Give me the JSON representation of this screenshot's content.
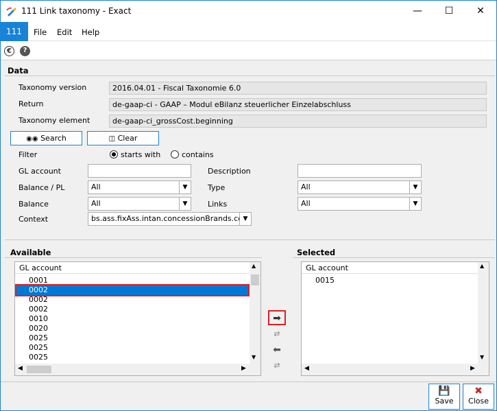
{
  "window": {
    "title": "111 Link taxonomy - Exact",
    "minimize": "—",
    "maximize": "☐",
    "close": "✕"
  },
  "menu": {
    "badge": "111",
    "items": [
      "File",
      "Edit",
      "Help"
    ]
  },
  "data_section": {
    "header": "Data",
    "taxonomy_version_label": "Taxonomy version",
    "taxonomy_version_value": "2016.04.01 - Fiscal Taxonomie 6.0",
    "return_label": "Return",
    "return_value": "de-gaap-ci - GAAP – Modul eBilanz steuerlicher Einzelabschluss",
    "taxonomy_element_label": "Taxonomy element",
    "taxonomy_element_value": "de-gaap-ci_grossCost.beginning",
    "search_label": "Search",
    "clear_label": "Clear",
    "filter_label": "Filter",
    "starts_with_label": "starts with",
    "contains_label": "contains",
    "gl_account_label": "GL account",
    "gl_account_value": "",
    "description_label": "Description",
    "description_value": "",
    "balance_pl_label": "Balance / PL",
    "balance_pl_value": "All",
    "type_label": "Type",
    "type_value": "All",
    "balance_label": "Balance",
    "balance_value": "All",
    "links_label": "Links",
    "links_value": "All",
    "context_label": "Context",
    "context_value": "bs.ass.fixAss.intan.concessionBrands.cor"
  },
  "available": {
    "header": "Available",
    "column": "GL account",
    "rows": [
      "0001",
      "0002",
      "0002",
      "0002",
      "0010",
      "0020",
      "0025",
      "0025",
      "0025"
    ],
    "selected_index": 1
  },
  "selected": {
    "header": "Selected",
    "column": "GL account",
    "rows": [
      "0015"
    ]
  },
  "footer": {
    "save_label": "Save",
    "close_label": "Close"
  },
  "colors": {
    "accent": "#1883d7",
    "selection": "#0078d7",
    "highlight_border": "#e02020"
  }
}
